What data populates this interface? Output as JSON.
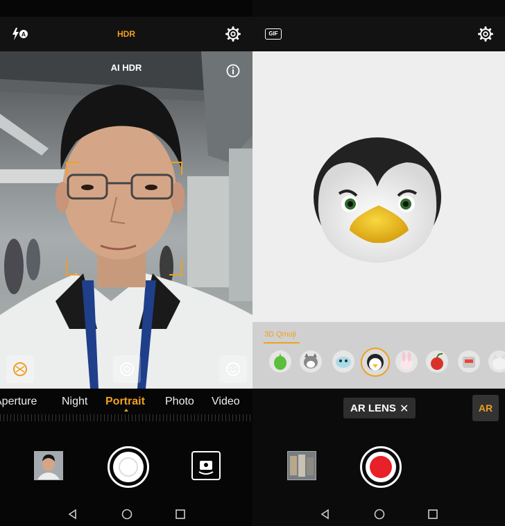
{
  "left_screen": {
    "top_bar": {
      "flash_icon": "flash-auto-icon",
      "hdr_label": "HDR",
      "settings_icon": "gear-icon"
    },
    "viewfinder": {
      "ai_hdr_label": "AI HDR",
      "info_icon": "info-icon"
    },
    "quick_icons": [
      "aperture-icon",
      "beauty-icon",
      "selfie-swap-icon"
    ],
    "modes": [
      "Aperture",
      "Night",
      "Portrait",
      "Photo",
      "Video"
    ],
    "active_mode": "Portrait",
    "bottom": {
      "gallery_thumb": "gallery-thumbnail",
      "shutter": "shutter-button",
      "switch_camera": "switch-camera-icon"
    }
  },
  "right_screen": {
    "top_bar": {
      "gif_label": "GIF",
      "settings_icon": "gear-icon"
    },
    "qmoji": {
      "tab_label": "3D Qmoji",
      "items": [
        "frog",
        "husky",
        "fish",
        "penguin",
        "rabbit",
        "cherry",
        "robot",
        "cat"
      ],
      "selected": "penguin"
    },
    "ar_lens": {
      "label": "AR LENS",
      "close": "✕",
      "ar_button": "AR"
    },
    "bottom": {
      "gallery_thumb": "gallery-thumbnail",
      "record": "record-button"
    }
  },
  "nav": [
    "back-icon",
    "home-icon",
    "recents-icon"
  ],
  "colors": {
    "accent": "#f0a020",
    "record": "#e8202a"
  }
}
